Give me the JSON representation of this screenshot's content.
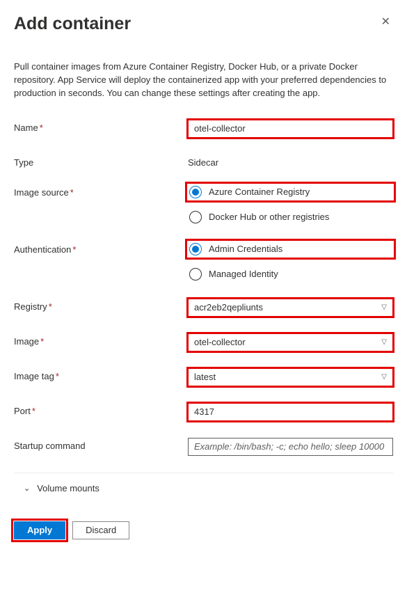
{
  "header": {
    "title": "Add container"
  },
  "description": "Pull container images from Azure Container Registry, Docker Hub, or a private Docker repository. App Service will deploy the containerized app with your preferred dependencies to production in seconds. You can change these settings after creating the app.",
  "labels": {
    "name": "Name",
    "type": "Type",
    "image_source": "Image source",
    "authentication": "Authentication",
    "registry": "Registry",
    "image": "Image",
    "image_tag": "Image tag",
    "port": "Port",
    "startup_command": "Startup command",
    "volume_mounts": "Volume mounts"
  },
  "values": {
    "name": "otel-collector",
    "type": "Sidecar",
    "registry": "acr2eb2qepliunts",
    "image": "otel-collector",
    "image_tag": "latest",
    "port": "4317",
    "startup_placeholder": "Example: /bin/bash; -c; echo hello; sleep 10000"
  },
  "image_source_options": {
    "acr": "Azure Container Registry",
    "docker": "Docker Hub or other registries"
  },
  "auth_options": {
    "admin": "Admin Credentials",
    "managed": "Managed Identity"
  },
  "buttons": {
    "apply": "Apply",
    "discard": "Discard"
  },
  "required_marker": "*"
}
